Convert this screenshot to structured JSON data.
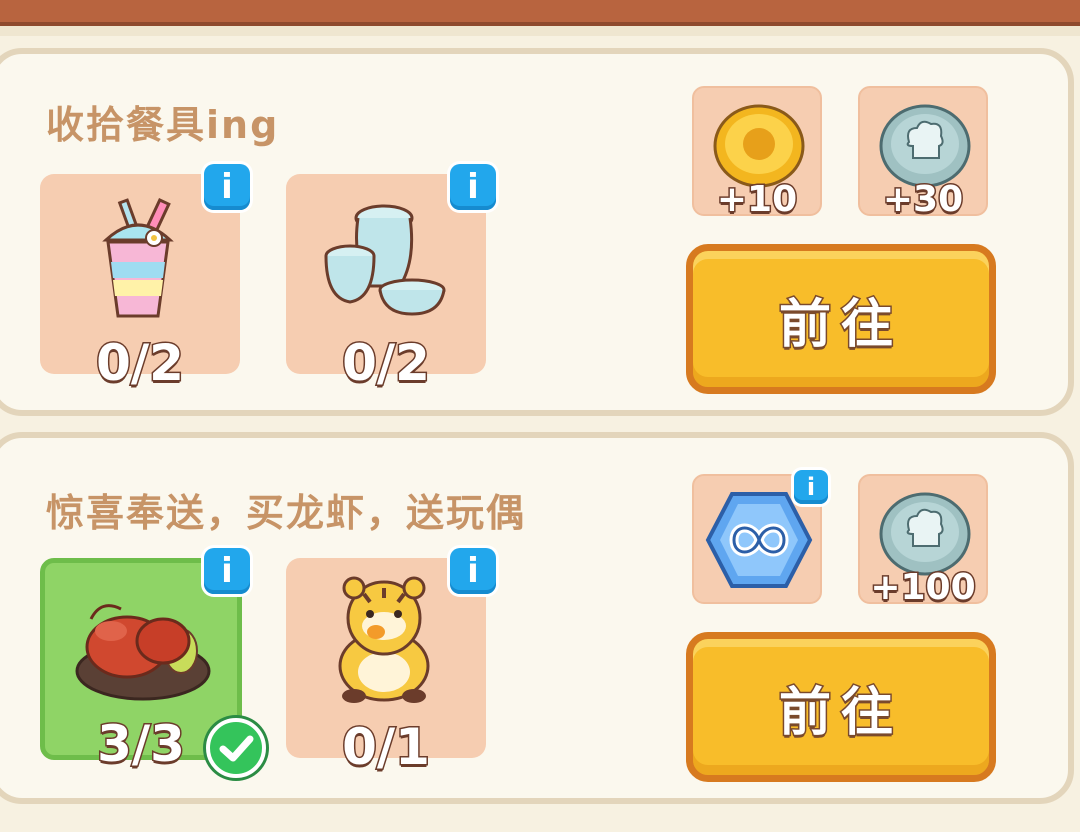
{
  "tasks": [
    {
      "title": "收拾餐具ing",
      "items": [
        {
          "name": "rainbow drink cup",
          "count": "0/2",
          "completed": false
        },
        {
          "name": "ceramic tableware set",
          "count": "0/2",
          "completed": false
        }
      ],
      "rewards": [
        {
          "icon": "gold-coin-icon",
          "amount": "+10"
        },
        {
          "icon": "chef-hat-coin-icon",
          "amount": "+30"
        }
      ],
      "go_label": "前往"
    },
    {
      "title": "惊喜奉送，买龙虾，送玩偶",
      "items": [
        {
          "name": "lobster platter",
          "count": "3/3",
          "completed": true
        },
        {
          "name": "tiger plush doll",
          "count": "0/1",
          "completed": false
        }
      ],
      "rewards": [
        {
          "icon": "infinity-hexagon-icon",
          "amount": ""
        },
        {
          "icon": "chef-hat-coin-icon",
          "amount": "+100"
        }
      ],
      "go_label": "前往"
    }
  ],
  "colors": {
    "card_bg": "#fbf8ee",
    "slot_bg": "#f6cdb1",
    "done_bg": "#8fd466",
    "button_bg": "#f8bd2a",
    "info_blue": "#22a7ec"
  }
}
